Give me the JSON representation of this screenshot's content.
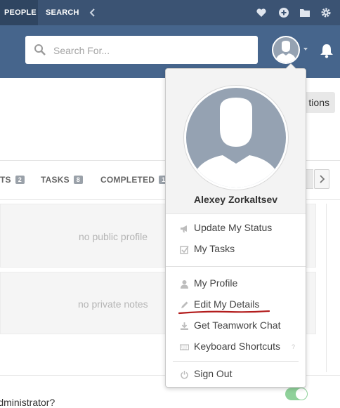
{
  "nav": {
    "people_label": "PEOPLE",
    "search_label": "SEARCH"
  },
  "search": {
    "placeholder": "Search For..."
  },
  "main": {
    "options_label": "tions",
    "tabs": [
      {
        "label": "TS",
        "badge": "2"
      },
      {
        "label": "TASKS",
        "badge": "8"
      },
      {
        "label": "COMPLETED",
        "badge": "1"
      }
    ],
    "public_profile_text": "no public profile",
    "private_notes_text": "no private notes",
    "admin_question": "Administrator?"
  },
  "menu": {
    "user_name": "Alexey Zorkaltsev",
    "items": [
      {
        "label": "Update My Status",
        "icon": "megaphone-icon"
      },
      {
        "label": "My Tasks",
        "icon": "checkbox-icon"
      },
      {
        "label": "My Profile",
        "icon": "person-icon"
      },
      {
        "label": "Edit My Details",
        "icon": "pencil-icon"
      },
      {
        "label": "Get Teamwork Chat",
        "icon": "download-icon"
      },
      {
        "label": "Keyboard Shortcuts",
        "icon": "keyboard-icon"
      },
      {
        "label": "Sign Out",
        "icon": "power-icon"
      }
    ],
    "shortcut_help": "?"
  },
  "colors": {
    "nav_bg": "#3b5373",
    "header_bg": "#46658c",
    "avatar_bg": "#95a2b2",
    "underline": "#b31d1d",
    "toggle_on": "#8fd19a"
  }
}
